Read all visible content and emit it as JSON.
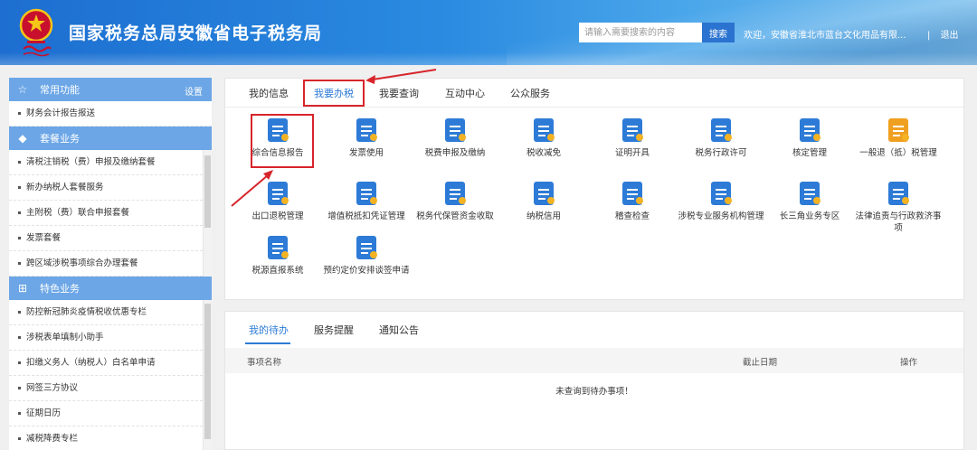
{
  "header": {
    "title": "国家税务总局安徽省电子税务局",
    "search_placeholder": "请输入需要搜索的内容",
    "search_button": "搜索",
    "welcome": "欢迎，安徽省淮北市蓝台文化用品有限...",
    "separator": "|",
    "logout": "退出"
  },
  "sidebar": {
    "common": {
      "label": "常用功能",
      "settings": "设置",
      "items": [
        "财务会计报告报送"
      ]
    },
    "package": {
      "label": "套餐业务",
      "items": [
        "清税注销税（费）申报及缴纳套餐",
        "新办纳税人套餐服务",
        "主附税（费）联合申报套餐",
        "发票套餐",
        "跨区域涉税事项综合办理套餐"
      ]
    },
    "special": {
      "label": "特色业务",
      "items": [
        "防控新冠肺炎疫情税收优惠专栏",
        "涉税表单填制小助手",
        "扣缴义务人（纳税人）白名单申请",
        "网签三方协议",
        "征期日历",
        "减税降费专栏"
      ]
    }
  },
  "main_tabs": [
    "我的信息",
    "我要办税",
    "我要查询",
    "互动中心",
    "公众服务"
  ],
  "main_tab_active": "我要办税",
  "functions": [
    "综合信息报告",
    "发票使用",
    "税费申报及缴纳",
    "税收减免",
    "证明开具",
    "税务行政许可",
    "核定管理",
    "一般退（抵）税管理",
    "出口退税管理",
    "增值税抵扣凭证管理",
    "税务代保管资金收取",
    "纳税信用",
    "稽查检查",
    "涉税专业服务机构管理",
    "长三角业务专区",
    "法律追责与行政救济事项",
    "税源直报系统",
    "预约定价安排谈签申请"
  ],
  "bottom_tabs": [
    "我的待办",
    "服务提醒",
    "通知公告"
  ],
  "bottom_tab_active": "我的待办",
  "table": {
    "col_name": "事项名称",
    "col_date": "截止日期",
    "col_action": "操作",
    "empty": "未查询到待办事项！"
  },
  "colors": {
    "primary": "#2d7bd6",
    "sidebar_header": "#6ca6e6",
    "annotation": "#d7252b"
  }
}
